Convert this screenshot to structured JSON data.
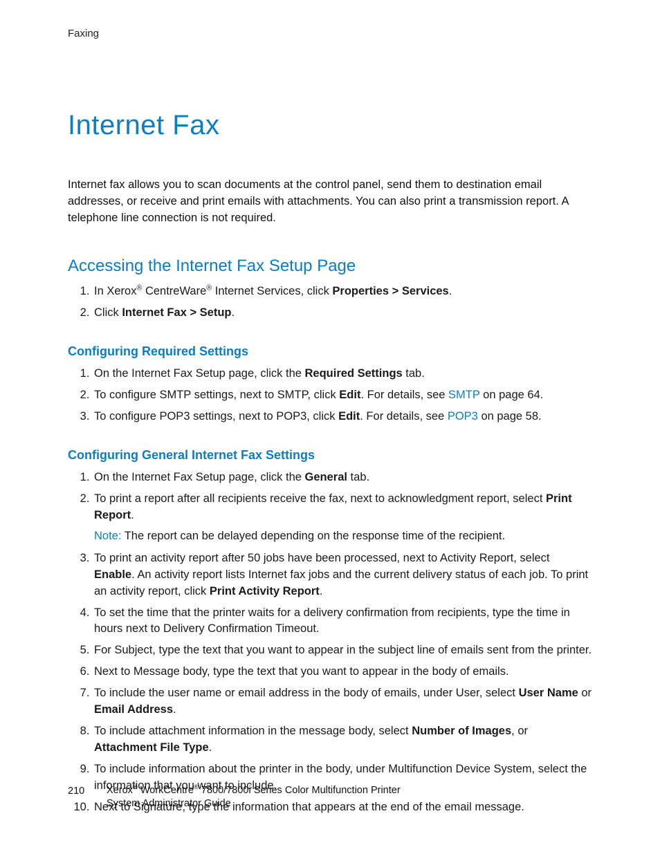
{
  "header": {
    "running": "Faxing"
  },
  "title": "Internet Fax",
  "intro": "Internet fax allows you to scan documents at the control panel, send them to destination email addresses, or receive and print emails with attachments. You can also print a transmission report. A telephone line connection is not required.",
  "section1": {
    "heading": "Accessing the Internet Fax Setup Page",
    "step1_a": "In Xerox",
    "step1_b": " CentreWare",
    "step1_c": " Internet Services, click ",
    "step1_bold": "Properties > Services",
    "step1_end": ".",
    "step2_a": "Click ",
    "step2_bold": "Internet Fax > Setup",
    "step2_end": "."
  },
  "sub1": {
    "heading": "Configuring Required Settings",
    "s1_a": "On the Internet Fax Setup page, click the ",
    "s1_bold": "Required Settings",
    "s1_b": " tab.",
    "s2_a": "To configure SMTP settings, next to SMTP, click ",
    "s2_bold": "Edit",
    "s2_b": ". For details, see ",
    "s2_link": "SMTP",
    "s2_c": " on page 64.",
    "s3_a": "To configure POP3 settings, next to POP3, click ",
    "s3_bold": "Edit",
    "s3_b": ". For details, see ",
    "s3_link": "POP3",
    "s3_c": " on page 58."
  },
  "sub2": {
    "heading": "Configuring General Internet Fax Settings",
    "s1_a": "On the Internet Fax Setup page, click the ",
    "s1_bold": "General",
    "s1_b": " tab.",
    "s2_a": "To print a report after all recipients receive the fax, next to acknowledgment report, select ",
    "s2_bold": "Print Report",
    "s2_b": ".",
    "note_label": "Note:",
    "note_text": " The report can be delayed depending on the response time of the recipient.",
    "s3_a": "To print an activity report after 50 jobs have been processed, next to Activity Report, select ",
    "s3_bold": "Enable",
    "s3_b": ". An activity report lists Internet fax jobs and the current delivery status of each job. To print an activity report, click ",
    "s3_bold2": "Print Activity Report",
    "s3_c": ".",
    "s4": "To set the time that the printer waits for a delivery confirmation from recipients, type the time in hours next to Delivery Confirmation Timeout.",
    "s5": "For Subject, type the text that you want to appear in the subject line of emails sent from the printer.",
    "s6": "Next to Message body, type the text that you want to appear in the body of emails.",
    "s7_a": "To include the user name or email address in the body of emails, under User, select ",
    "s7_bold1": "User Name",
    "s7_b": " or ",
    "s7_bold2": "Email Address",
    "s7_c": ".",
    "s8_a": "To include attachment information in the message body, select ",
    "s8_bold1": "Number of Images",
    "s8_b": ", or ",
    "s8_bold2": "Attachment File Type",
    "s8_c": ".",
    "s9": "To include information about the printer in the body, under Multifunction Device System, select the information that you want to include.",
    "s10": "Next to Signature, type the information that appears at the end of the email message."
  },
  "footer": {
    "page": "210",
    "line_a": "Xerox",
    "line_b": " WorkCentre",
    "line_c": " 7800/7800i Series Color Multifunction Printer",
    "line2": "System Administrator Guide"
  },
  "reg": "®"
}
